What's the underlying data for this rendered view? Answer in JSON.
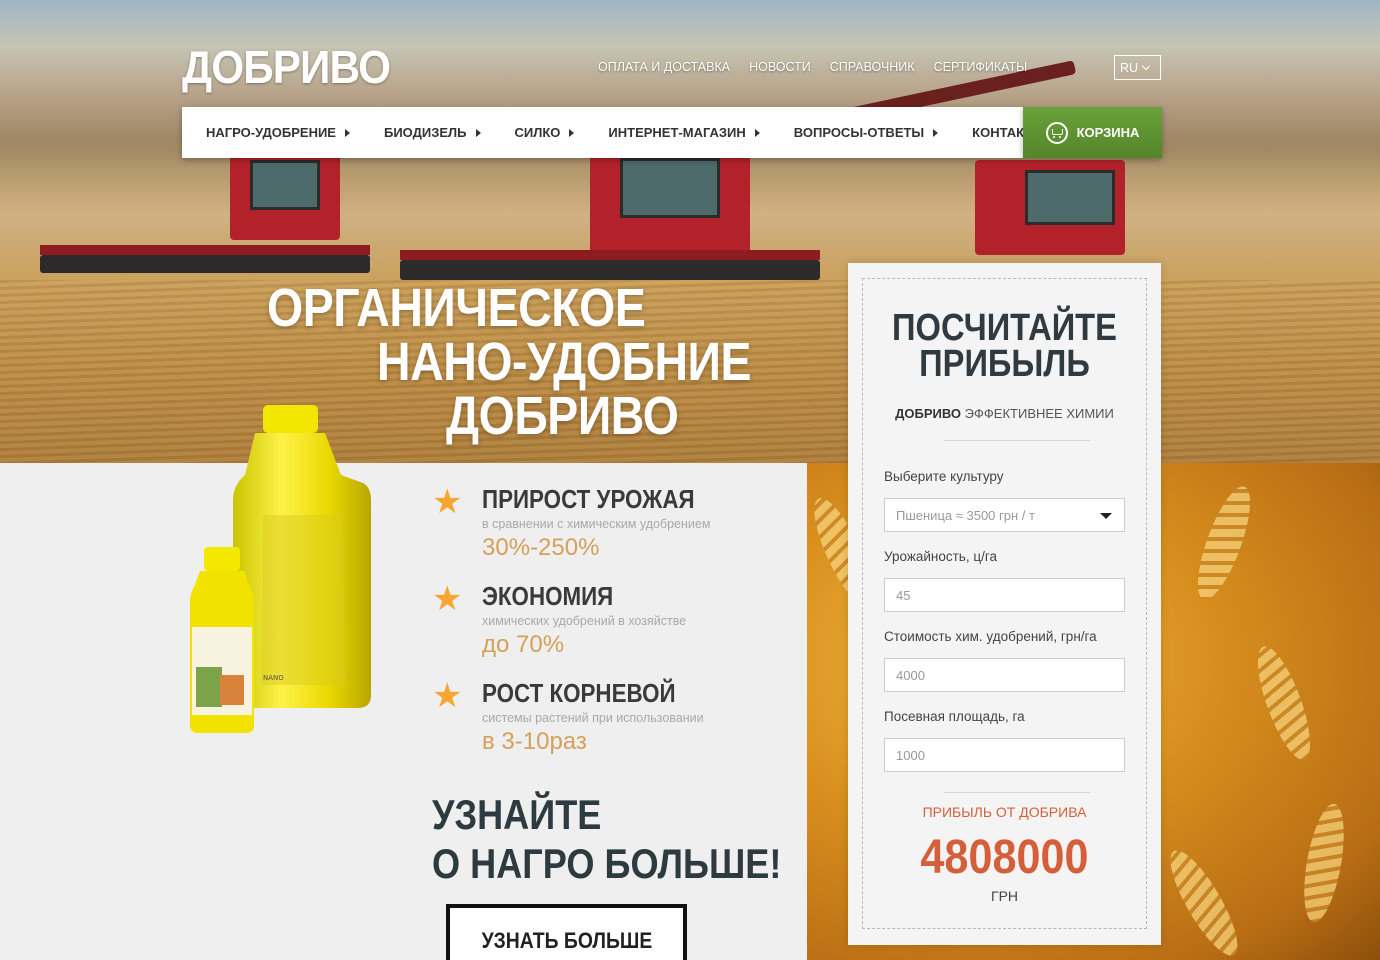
{
  "header": {
    "logo": "ДОБРИВО",
    "top_links": [
      "ОПЛАТА И ДОСТАВКА",
      "НОВОСТИ",
      "СПРАВОЧНИК",
      "СЕРТИФИКАТЫ"
    ],
    "language": "RU"
  },
  "nav": {
    "items": [
      "НАГРО-УДОБРЕНИЕ",
      "БИОДИЗЕЛЬ",
      "СИЛКО",
      "ИНТЕРНЕТ-МАГАЗИН",
      "ВОПРОСЫ-ОТВЕТЫ",
      "КОНТАКТЫ"
    ],
    "cart_label": "КОРЗИНА"
  },
  "hero": {
    "line1": "ОРГАНИЧЕСКОЕ",
    "line2": "НАНО-УДОБНИЕ",
    "line3": "ДОБРИВО"
  },
  "benefits": [
    {
      "title": "ПРИРОСТ УРОЖАЯ",
      "subtitle": "в сравнении с химическим удобрением",
      "value": "30%-250%"
    },
    {
      "title": "ЭКОНОМИЯ",
      "subtitle": "химических удобрений в хозяйстве",
      "value": "до 70%"
    },
    {
      "title": "РОСТ КОРНЕВОЙ",
      "subtitle": "системы растений при использовании",
      "value": "в 3-10раз"
    }
  ],
  "cta": {
    "line1": "УЗНАЙТЕ",
    "line2": "О НАГРО БОЛЬШЕ!",
    "button": "УЗНАТЬ БОЛЬШЕ"
  },
  "calculator": {
    "title_line1": "ПОСЧИТАЙТЕ",
    "title_line2": "ПРИБЫЛЬ",
    "subtitle_bold": "ДОБРИВО",
    "subtitle_rest": " ЭФФЕКТИВНЕЕ ХИМИИ",
    "culture_label": "Выберите культуру",
    "culture_value": "Пшеница ≈ 3500 грн / т",
    "yield_label": "Урожайность, ц/га",
    "yield_value": "45",
    "cost_label": "Стоимость хим. удобрений, грн/га",
    "cost_value": "4000",
    "area_label": "Посевная площадь, га",
    "area_value": "1000",
    "profit_label": "ПРИБЫЛЬ ОТ ДОБРИВА",
    "profit_value": "4808000",
    "profit_unit": "ГРН"
  },
  "colors": {
    "cart_green": "#5e942f",
    "accent_orange": "#d4603b",
    "benefit_value": "#d4a05a",
    "star": "#f7a533",
    "dark_title": "#2d3b40"
  },
  "icons": [
    "chevron-down-icon",
    "nav-arrow-icon",
    "cart-icon",
    "star-icon",
    "dropdown-caret-icon"
  ]
}
